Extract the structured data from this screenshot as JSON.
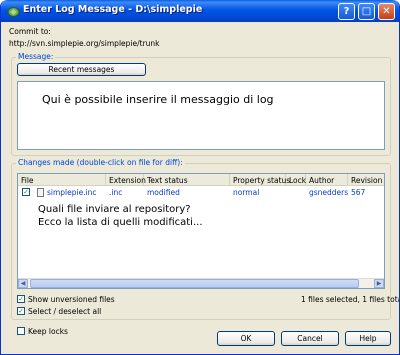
{
  "window": {
    "title": "Enter Log Message - D:\\simplepie",
    "help_glyph": "?",
    "maximize_glyph": "□",
    "close_glyph": "✕"
  },
  "commit": {
    "label": "Commit to:",
    "url": "http://svn.simplepie.org/simplepie/trunk"
  },
  "message_group": {
    "legend": "Message:",
    "recent_button": "Recent messages",
    "text": "Qui è possibile inserire il messaggio di log"
  },
  "changes_group": {
    "legend": "Changes made (double-click on file for diff):",
    "columns": [
      "File",
      "Extension",
      "Text status",
      "Property status",
      "Lock",
      "Author",
      "Revision"
    ],
    "rows": [
      {
        "checked": true,
        "file": "simplepie.inc",
        "extension": ".inc",
        "text_status": "modified",
        "property_status": "normal",
        "lock": "",
        "author": "gsnedders",
        "revision": "567"
      }
    ],
    "overlay_line1": "Quali file inviare al repository?",
    "overlay_line2": "Ecco la lista di quelli modificati..."
  },
  "options": {
    "show_unversioned": {
      "label": "Show unversioned files",
      "checked": true
    },
    "select_all": {
      "label": "Select / deselect all",
      "checked": true
    },
    "keep_locks": {
      "label": "Keep locks",
      "checked": false
    },
    "status": "1 files selected, 1 files total"
  },
  "buttons": {
    "ok": "OK",
    "cancel": "Cancel",
    "help": "Help"
  },
  "colors": {
    "title_bar": "#0055e5",
    "link_blue": "#0a3cc8",
    "legend_blue": "#0046d5",
    "dialog_bg": "#ece9d8"
  }
}
